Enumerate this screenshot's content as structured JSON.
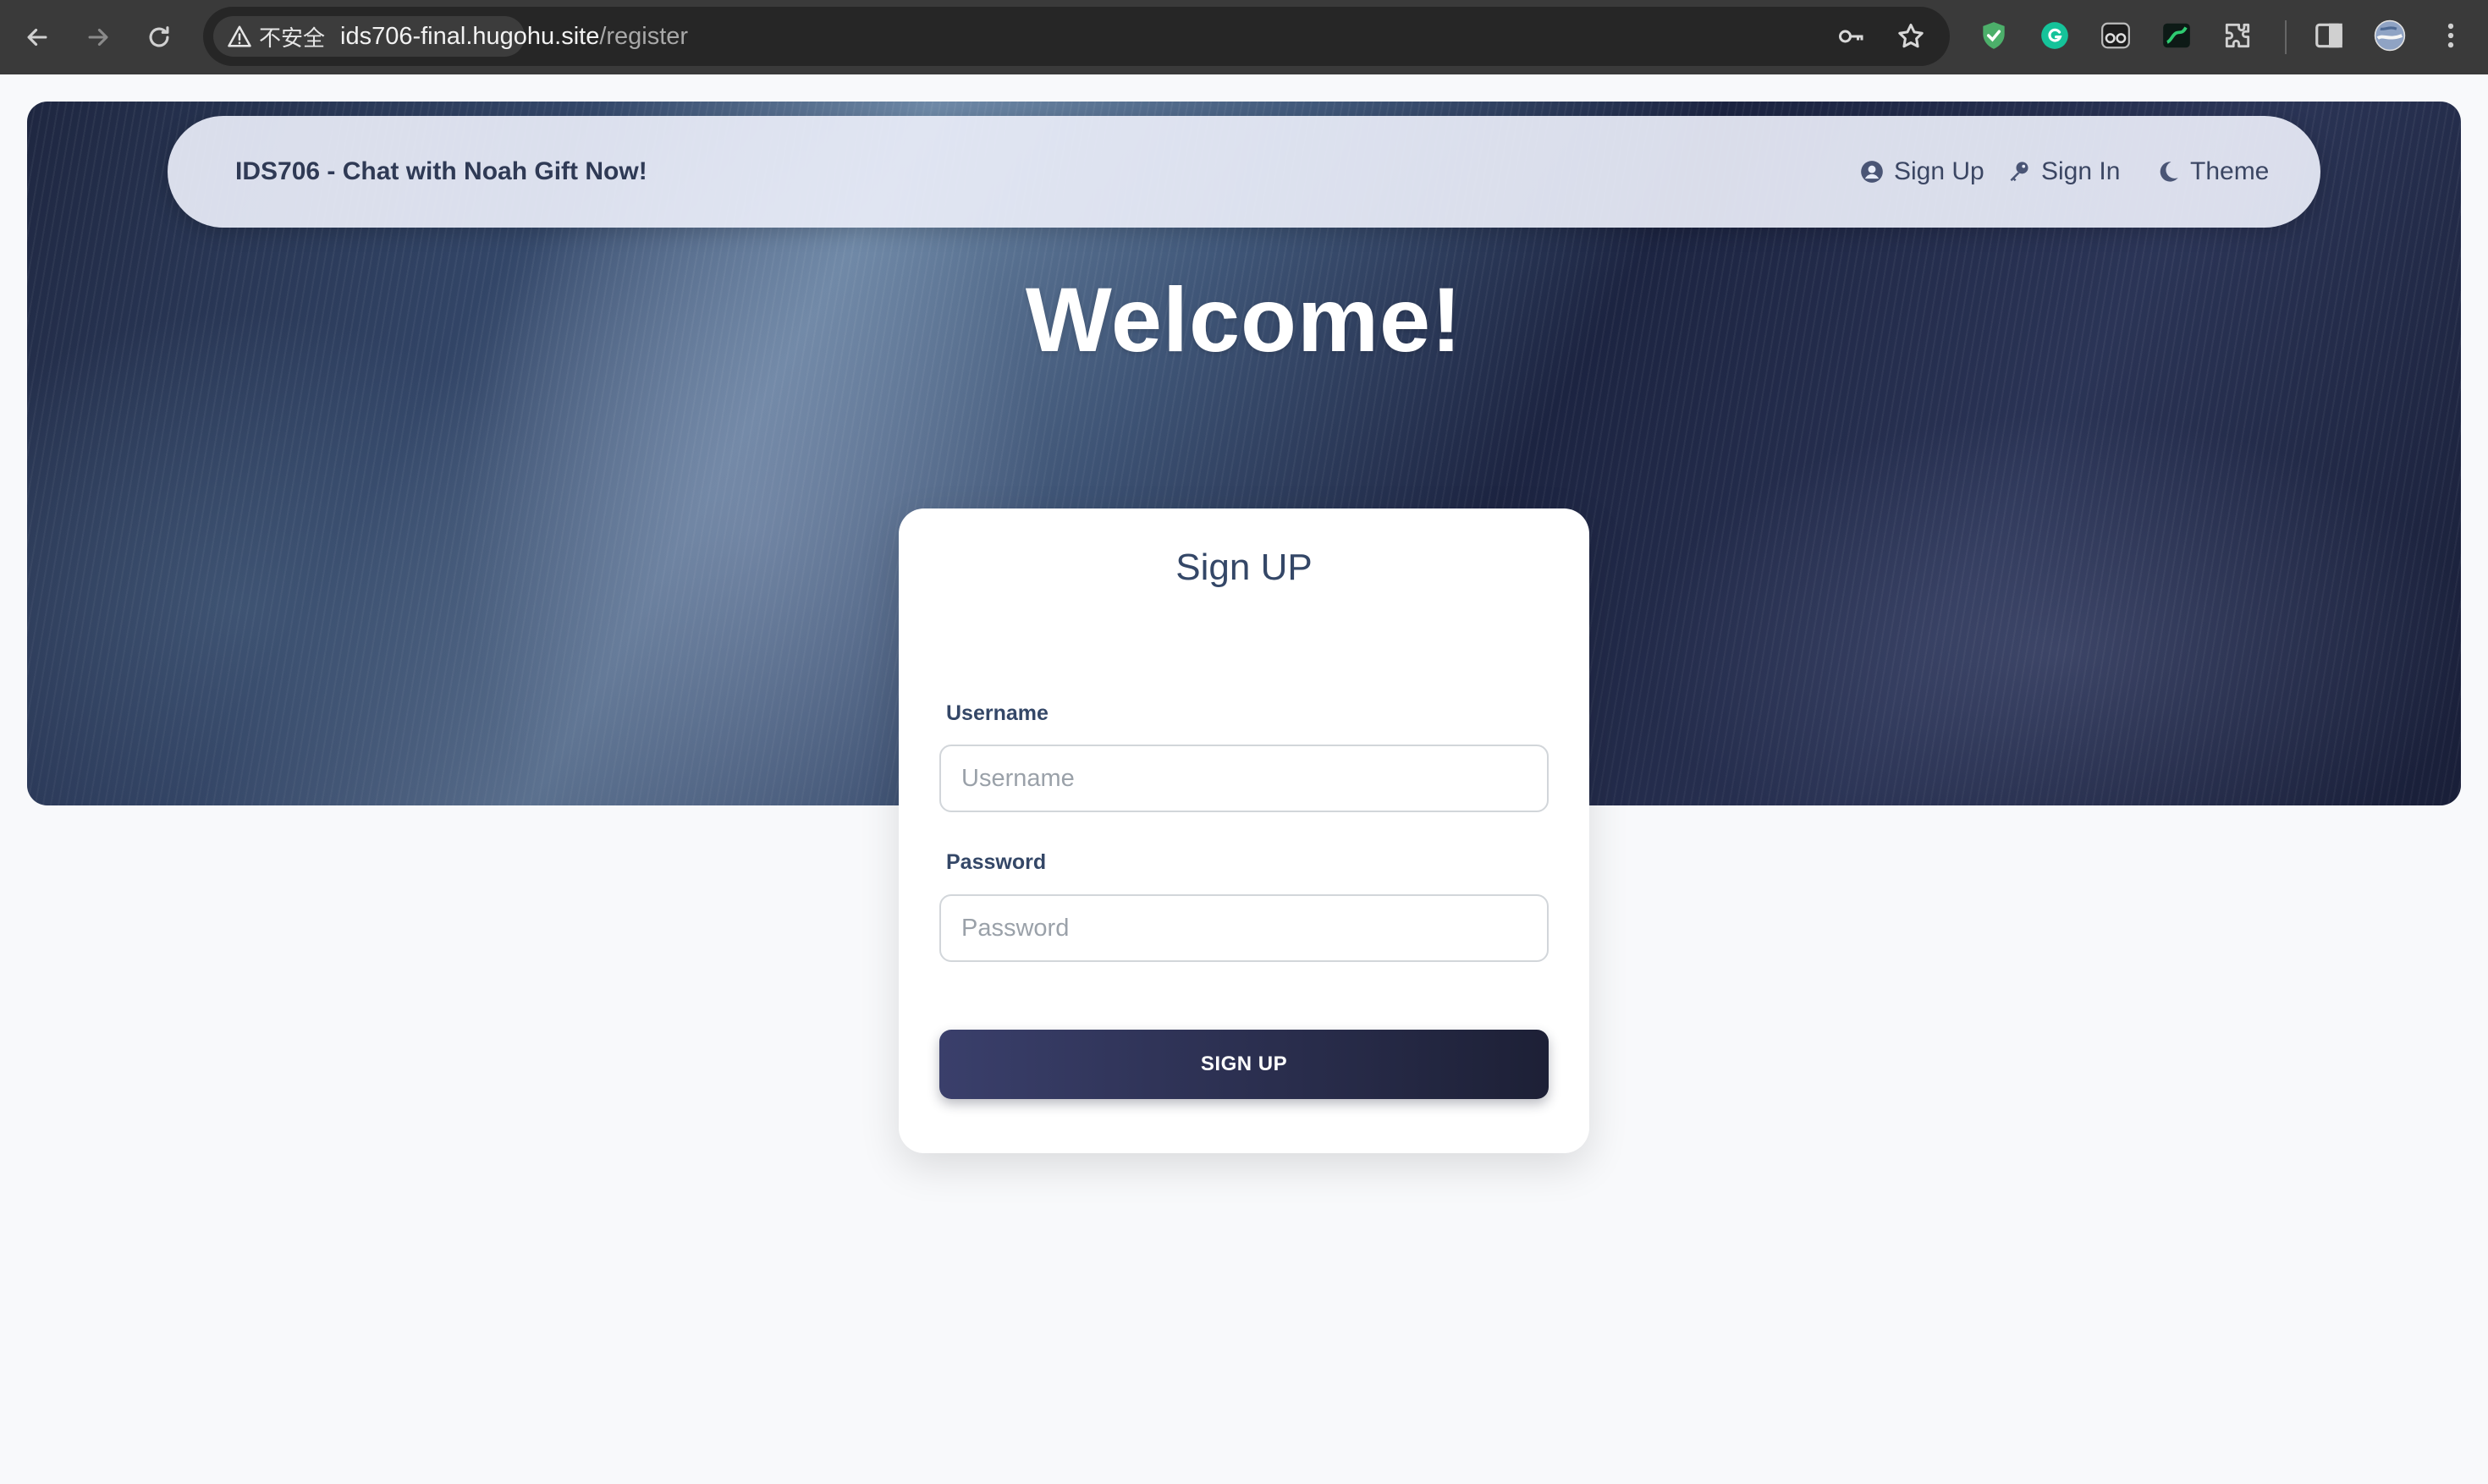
{
  "browser": {
    "security_label": "不安全",
    "url_host": "ids706-final.hugohu.site",
    "url_path": "/register",
    "icons": [
      "back-arrow-icon",
      "forward-arrow-icon",
      "reload-icon",
      "warning-triangle-icon",
      "key-icon",
      "star-icon",
      "shield-check-icon",
      "grammarly-icon",
      "reader-glasses-icon",
      "chart-extension-icon",
      "puzzle-icon",
      "sidebar-panel-icon",
      "profile-avatar-icon",
      "more-vertical-icon"
    ]
  },
  "navbar": {
    "brand": "IDS706 - Chat with Noah Gift Now!",
    "links": [
      {
        "label": "Sign Up",
        "icon": "user-circle-icon"
      },
      {
        "label": "Sign In",
        "icon": "key-icon"
      },
      {
        "label": "Theme",
        "icon": "moon-icon"
      }
    ]
  },
  "hero": {
    "title": "Welcome!"
  },
  "form": {
    "title": "Sign UP",
    "username_label": "Username",
    "username_placeholder": "Username",
    "password_label": "Password",
    "password_placeholder": "Password",
    "submit_label": "SIGN UP"
  },
  "colors": {
    "primary_text": "#344767",
    "button_start": "#3a3f6b",
    "button_end": "#1d2036",
    "page_background": "#f8f9fb"
  }
}
